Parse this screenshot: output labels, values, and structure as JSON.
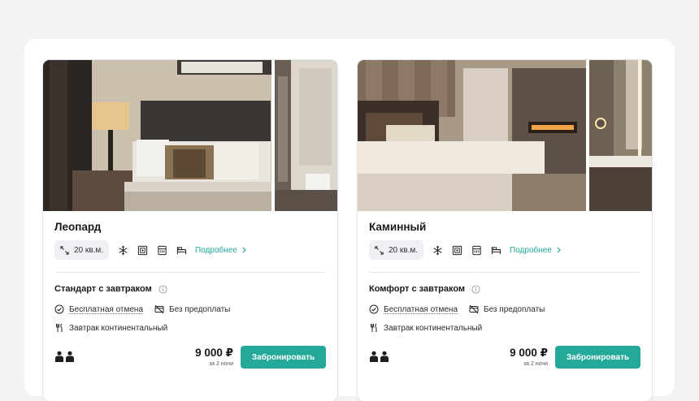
{
  "colors": {
    "accent": "#23a89a",
    "link": "#20a89a",
    "background": "#f2f3f5"
  },
  "common": {
    "area": "20 кв.м.",
    "more_label": "Подробнее",
    "free_cancel": "Бесплатная отмена",
    "no_prepay": "Без предоплаты",
    "breakfast": "Завтрак континентальный",
    "price_note": "за 2 ночи",
    "book_label": "Забронировать"
  },
  "amenity_icons": [
    "expand-icon",
    "air-conditioner-icon",
    "safe-icon",
    "minibar-icon",
    "bed-icon"
  ],
  "rooms": [
    {
      "name": "Леопард",
      "rate": "Стандарт с завтраком",
      "price": "9 000 ₽",
      "guests": 2
    },
    {
      "name": "Каминный",
      "rate": "Комфорт с завтраком",
      "price": "9 000 ₽",
      "guests": 2
    }
  ]
}
